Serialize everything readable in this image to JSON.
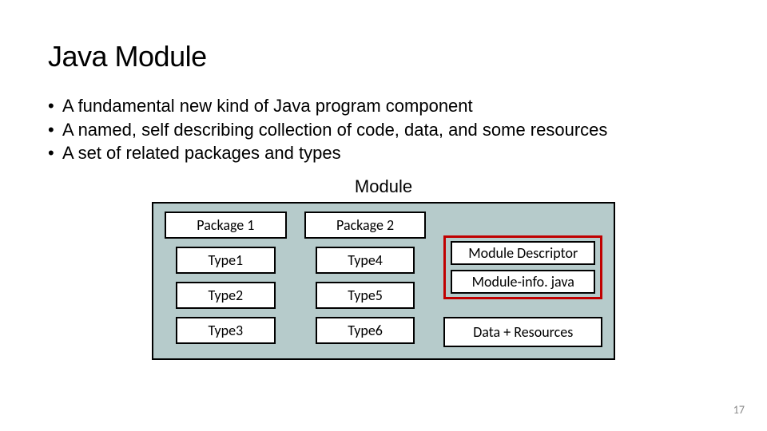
{
  "title": "Java Module",
  "bullets": [
    "A fundamental new kind of Java program component",
    "A named, self describing collection of code, data, and some resources",
    "A set of related packages and types"
  ],
  "module_label": "Module",
  "package1": {
    "header": "Package 1",
    "types": [
      "Type1",
      "Type2",
      "Type3"
    ]
  },
  "package2": {
    "header": "Package 2",
    "types": [
      "Type4",
      "Type5",
      "Type6"
    ]
  },
  "descriptor": {
    "title": "Module Descriptor",
    "file": "Module-info. java"
  },
  "resources": "Data + Resources",
  "page_number": "17"
}
